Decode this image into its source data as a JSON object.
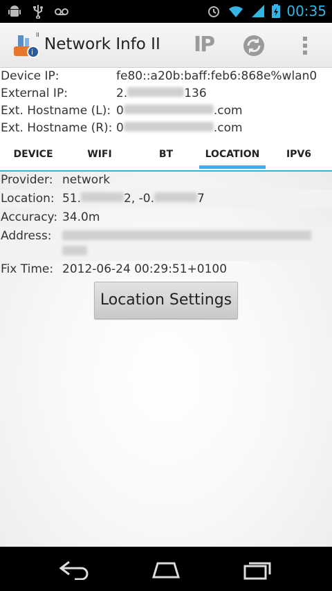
{
  "status_bar": {
    "time": "00:35",
    "left_icons": [
      "android-debug-icon",
      "usb-icon",
      "voicemail-icon"
    ],
    "right_icons": [
      "alarm-icon",
      "wifi-icon",
      "signal-icon",
      "battery-charging-icon"
    ]
  },
  "action_bar": {
    "title": "Network Info II",
    "ip_button": "IP",
    "app_icon": "network-info-app-icon",
    "refresh_icon": "refresh-icon",
    "overflow_icon": "overflow-menu-icon"
  },
  "network_info": [
    {
      "label": "Device IP:",
      "value": "fe80::a20b:baff:feb6:868e%wlan0"
    },
    {
      "label": "External IP:",
      "value_prefix": "2.",
      "value_suffix": "136"
    },
    {
      "label": "Ext. Hostname (L):",
      "value_prefix": "0",
      "value_suffix": ".com"
    },
    {
      "label": "Ext. Hostname (R):",
      "value_prefix": "0",
      "value_suffix": ".com"
    }
  ],
  "tabs": [
    {
      "label": "DEVICE",
      "active": false
    },
    {
      "label": "WIFI",
      "active": false
    },
    {
      "label": "BT",
      "active": false
    },
    {
      "label": "LOCATION",
      "active": true
    },
    {
      "label": "IPV6",
      "active": false
    }
  ],
  "location": {
    "provider_label": "Provider:",
    "provider_value": "network",
    "location_label": "Location:",
    "location_lat_prefix": "51.",
    "location_lat_suffix": "2, -0.",
    "location_lon_suffix": "7",
    "accuracy_label": "Accuracy:",
    "accuracy_value": "34.0m",
    "address_label": "Address:",
    "fix_time_label": "Fix Time:",
    "fix_time_value": "2012-06-24 00:29:51+0100",
    "settings_button": "Location Settings"
  },
  "nav_bar": {
    "back_icon": "back-icon",
    "home_icon": "home-icon",
    "recents_icon": "recent-apps-icon"
  },
  "colors": {
    "accent": "#33b5e5",
    "status_bar": "#000000",
    "action_bar": "#efefef"
  }
}
